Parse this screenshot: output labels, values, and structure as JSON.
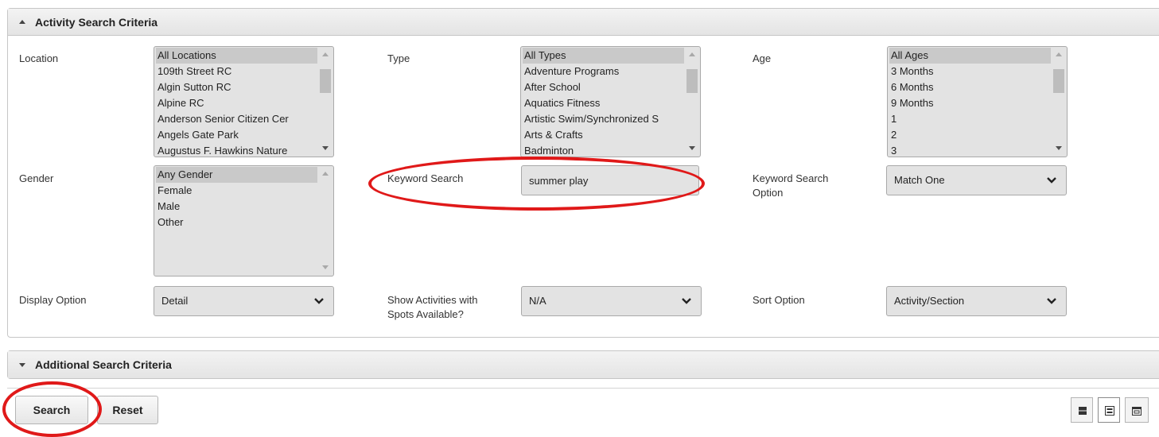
{
  "activity_panel": {
    "title": "Activity Search Criteria",
    "location": {
      "label": "Location",
      "options": [
        "All Locations",
        "109th Street RC",
        "Algin Sutton RC",
        "Alpine RC",
        "Anderson Senior Citizen Cer",
        "Angels Gate Park",
        "Augustus F. Hawkins Nature"
      ],
      "selected": "All Locations"
    },
    "type": {
      "label": "Type",
      "options": [
        "All Types",
        "Adventure Programs",
        "After School",
        "Aquatics Fitness",
        "Artistic Swim/Synchronized S",
        "Arts & Crafts",
        "Badminton"
      ],
      "selected": "All Types"
    },
    "age": {
      "label": "Age",
      "options": [
        "All Ages",
        "3 Months",
        "6 Months",
        "9 Months",
        "1",
        "2",
        "3"
      ],
      "selected": "All Ages"
    },
    "gender": {
      "label": "Gender",
      "options": [
        "Any Gender",
        "Female",
        "Male",
        "Other"
      ],
      "selected": "Any Gender"
    },
    "keyword": {
      "label": "Keyword Search",
      "value": "summer play"
    },
    "keyword_option": {
      "label_line1": "Keyword Search",
      "label_line2": "Option",
      "value": "Match One"
    },
    "display_option": {
      "label": "Display Option",
      "value": "Detail"
    },
    "spots_available": {
      "label_line1": "Show Activities with",
      "label_line2": "Spots Available?",
      "value": "N/A"
    },
    "sort_option": {
      "label": "Sort Option",
      "value": "Activity/Section"
    }
  },
  "additional_panel": {
    "title": "Additional Search Criteria"
  },
  "actions": {
    "search_label": "Search",
    "reset_label": "Reset"
  },
  "view_toggle": {
    "active_index": 1
  },
  "annotation_color": "#e01919"
}
